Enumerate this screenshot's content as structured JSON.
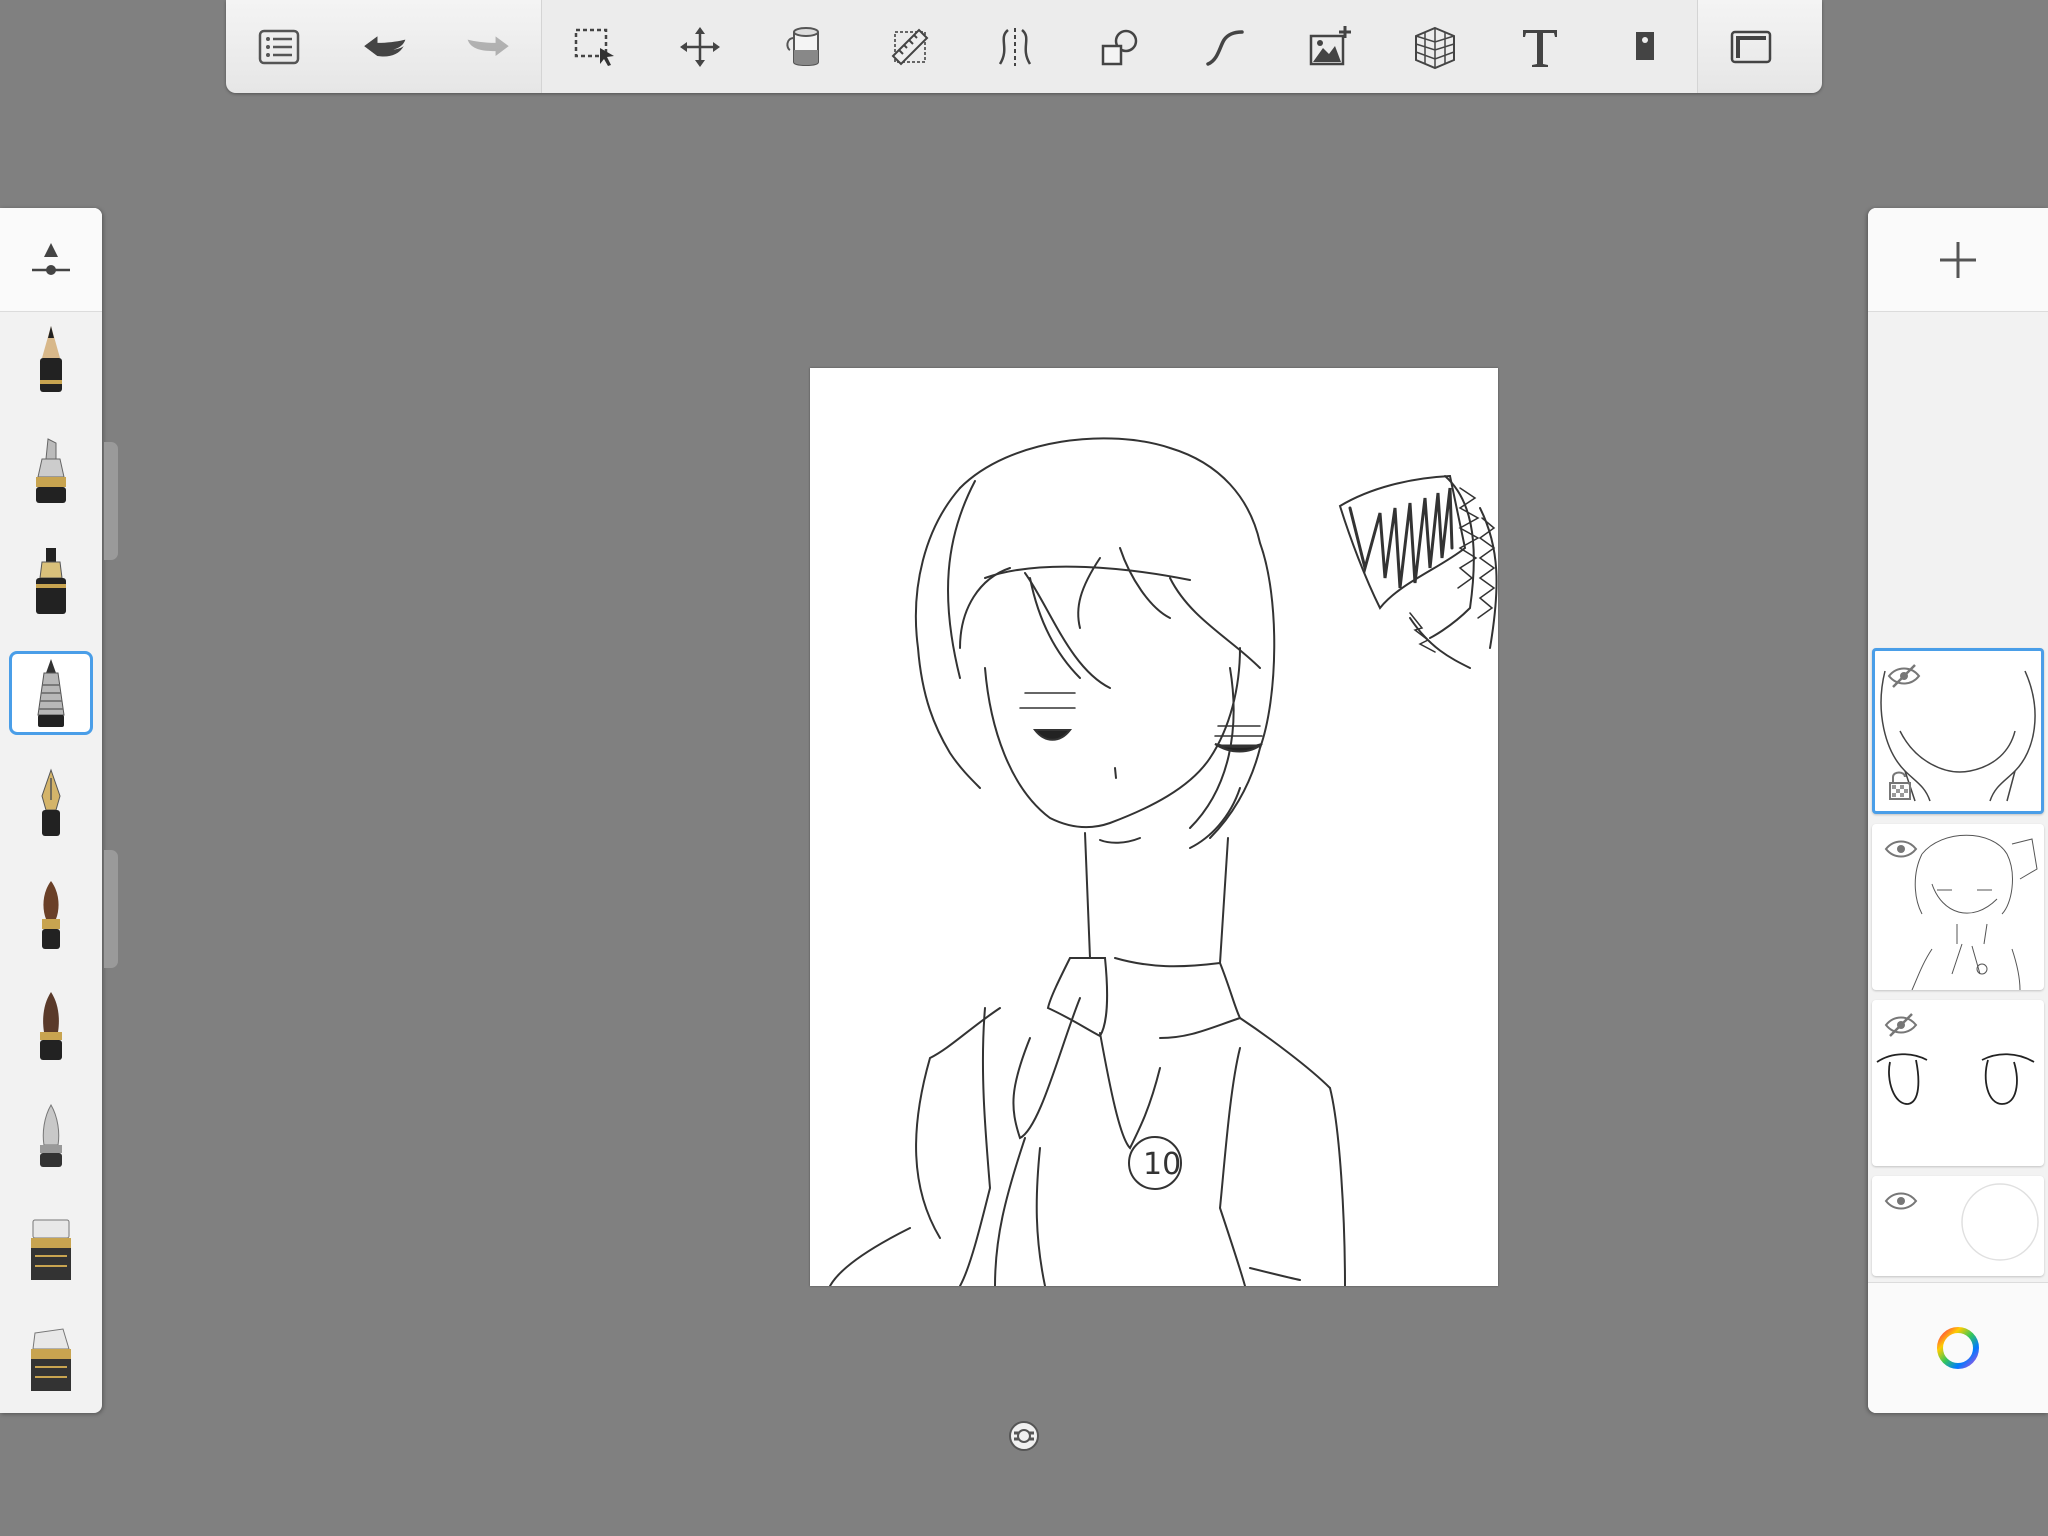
{
  "toolbar": {
    "items": [
      {
        "name": "layers-list-icon"
      },
      {
        "name": "undo-icon"
      },
      {
        "name": "redo-icon"
      },
      {
        "name": "selection-icon"
      },
      {
        "name": "transform-icon"
      },
      {
        "name": "fill-bucket-icon"
      },
      {
        "name": "ruler-icon"
      },
      {
        "name": "symmetry-icon"
      },
      {
        "name": "shapes-icon"
      },
      {
        "name": "curve-icon"
      },
      {
        "name": "add-image-icon"
      },
      {
        "name": "perspective-icon"
      },
      {
        "name": "text-icon"
      },
      {
        "name": "stencil-icon"
      },
      {
        "name": "fullscreen-icon"
      }
    ]
  },
  "brushes": [
    {
      "name": "pencil"
    },
    {
      "name": "marker"
    },
    {
      "name": "ink-pen"
    },
    {
      "name": "ballpoint",
      "selected": true
    },
    {
      "name": "fountain-pen"
    },
    {
      "name": "paintbrush"
    },
    {
      "name": "airbrush"
    },
    {
      "name": "smudge"
    },
    {
      "name": "eraser-hard"
    },
    {
      "name": "eraser-soft"
    }
  ],
  "layers": [
    {
      "name": "layer-1",
      "visible": false,
      "selected": true,
      "locked": true
    },
    {
      "name": "layer-2",
      "visible": true
    },
    {
      "name": "layer-3",
      "visible": false
    },
    {
      "name": "background-layer",
      "visible": true
    }
  ],
  "colors": {
    "accent": "#4a9ee8",
    "workspace": "#808080",
    "panel": "#f2f2f2"
  }
}
